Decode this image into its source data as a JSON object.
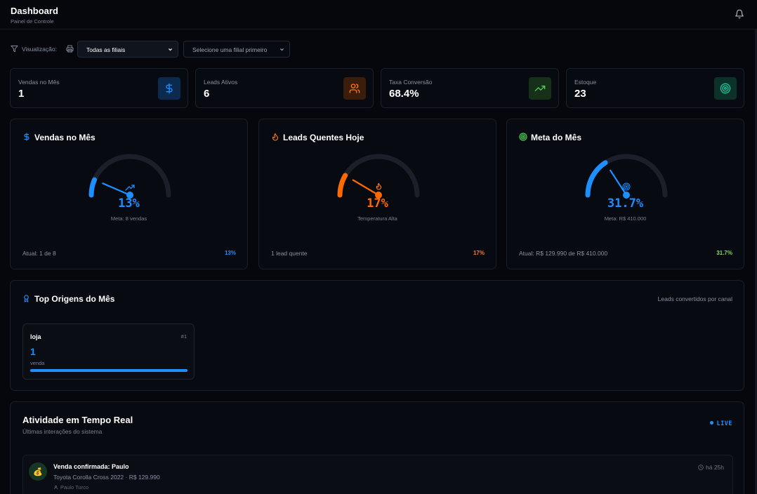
{
  "header": {
    "title": "Dashboard",
    "subtitle": "Painel de Controle",
    "bell_icon": "bell-icon"
  },
  "filters": {
    "label": "Visualização:",
    "filter_icon": "filter-icon",
    "print_icon": "printer-icon",
    "branch_select": "Todas as filiais",
    "sub_select": "Selecione uma filial primeiro"
  },
  "stats": [
    {
      "label": "Vendas no Mês",
      "value": "1",
      "icon": "dollar-icon",
      "color": "#1e8fff"
    },
    {
      "label": "Leads Ativos",
      "value": "6",
      "icon": "users-icon",
      "color": "#ff7a1a"
    },
    {
      "label": "Taxa Conversão",
      "value": "68.4%",
      "icon": "trending-up-icon",
      "color": "#4ccf52"
    },
    {
      "label": "Estoque",
      "value": "23",
      "icon": "target-icon",
      "color": "#22c49a"
    }
  ],
  "gauges": [
    {
      "title": "Vendas no Mês",
      "icon": "dollar-icon",
      "percent_label": "13%",
      "percent": 0.13,
      "subtitle": "Meta: 8 vendas",
      "footer_left": "Atual: 1 de 8",
      "footer_right": "13%",
      "color": "#1e8fff",
      "footer_color": "#1e8fff"
    },
    {
      "title": "Leads Quentes Hoje",
      "icon": "flame-icon",
      "percent_label": "17%",
      "percent": 0.17,
      "subtitle": "Temperatura Alta",
      "footer_left": "1 lead quente",
      "footer_right": "17%",
      "color": "#ff6a00",
      "footer_color": "#ff7a1a"
    },
    {
      "title": "Meta do Mês",
      "icon": "target-icon",
      "percent_label": "31.7%",
      "percent": 0.317,
      "subtitle": "Meta: R$ 410.000",
      "footer_left": "Atual: R$ 129.990 de R$ 410.000",
      "footer_right": "31.7%",
      "color": "#1e8fff",
      "footer_color": "#7ed957"
    }
  ],
  "origins": {
    "title": "Top Origens do Mês",
    "icon": "award-icon",
    "note": "Leads convertidos por canal",
    "items": [
      {
        "name": "loja",
        "rank": "#1",
        "value": "1",
        "unit": "venda",
        "share": 1.0
      }
    ]
  },
  "activity": {
    "title": "Atividade em Tempo Real",
    "subtitle": "Últimas interações do sistema",
    "live": "LIVE",
    "items": [
      {
        "icon": "money-bag-icon",
        "headline": "Venda confirmada: Paulo",
        "detail": "Toyota Corolla Cross 2022 · R$ 129.990",
        "user": "Paulo Turco",
        "time": "há 25h"
      }
    ]
  }
}
